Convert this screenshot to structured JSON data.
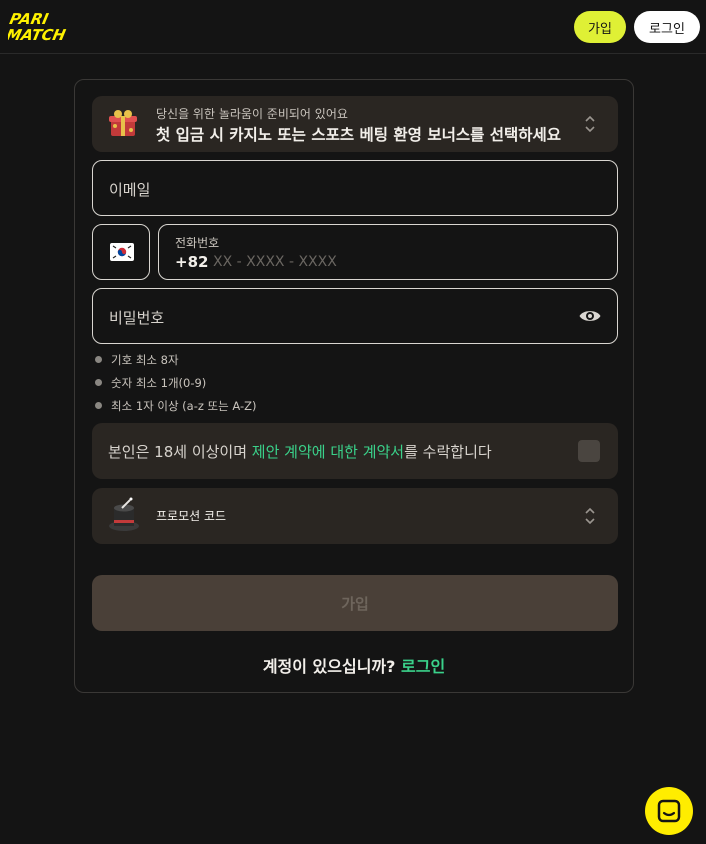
{
  "header": {
    "logo_text": "PARI MATCH",
    "signup_label": "가입",
    "login_label": "로그인"
  },
  "form": {
    "bonus": {
      "subtitle": "당신을 위한 놀라움이 준비되어 있어요",
      "title": "첫 입금 시 카지노 또는 스포츠 베팅 환영 보너스를 선택하세요"
    },
    "email": {
      "placeholder": "이메일"
    },
    "phone": {
      "country_flag": "kr-flag-icon",
      "label": "전화번호",
      "prefix": "+82",
      "placeholder": "XX - XXXX - XXXX"
    },
    "password": {
      "placeholder": "비밀번호"
    },
    "password_rules": [
      "기호 최소 8자",
      "숫자 최소 1개(0-9)",
      "최소 1자 이상 (a-z 또는 A-Z)"
    ],
    "terms": {
      "prefix": "본인은 18세 이상이며 ",
      "link": "제안 계약에 대한 계약서",
      "suffix": "를 수락합니다"
    },
    "promo": {
      "label": "프로모션 코드"
    },
    "submit_label": "가입",
    "have_account": {
      "text": "계정이 있으십니까?",
      "link": "로그인"
    }
  },
  "colors": {
    "accent_yellow": "#dff035",
    "link_green": "#3ad18a",
    "background": "#141414"
  }
}
